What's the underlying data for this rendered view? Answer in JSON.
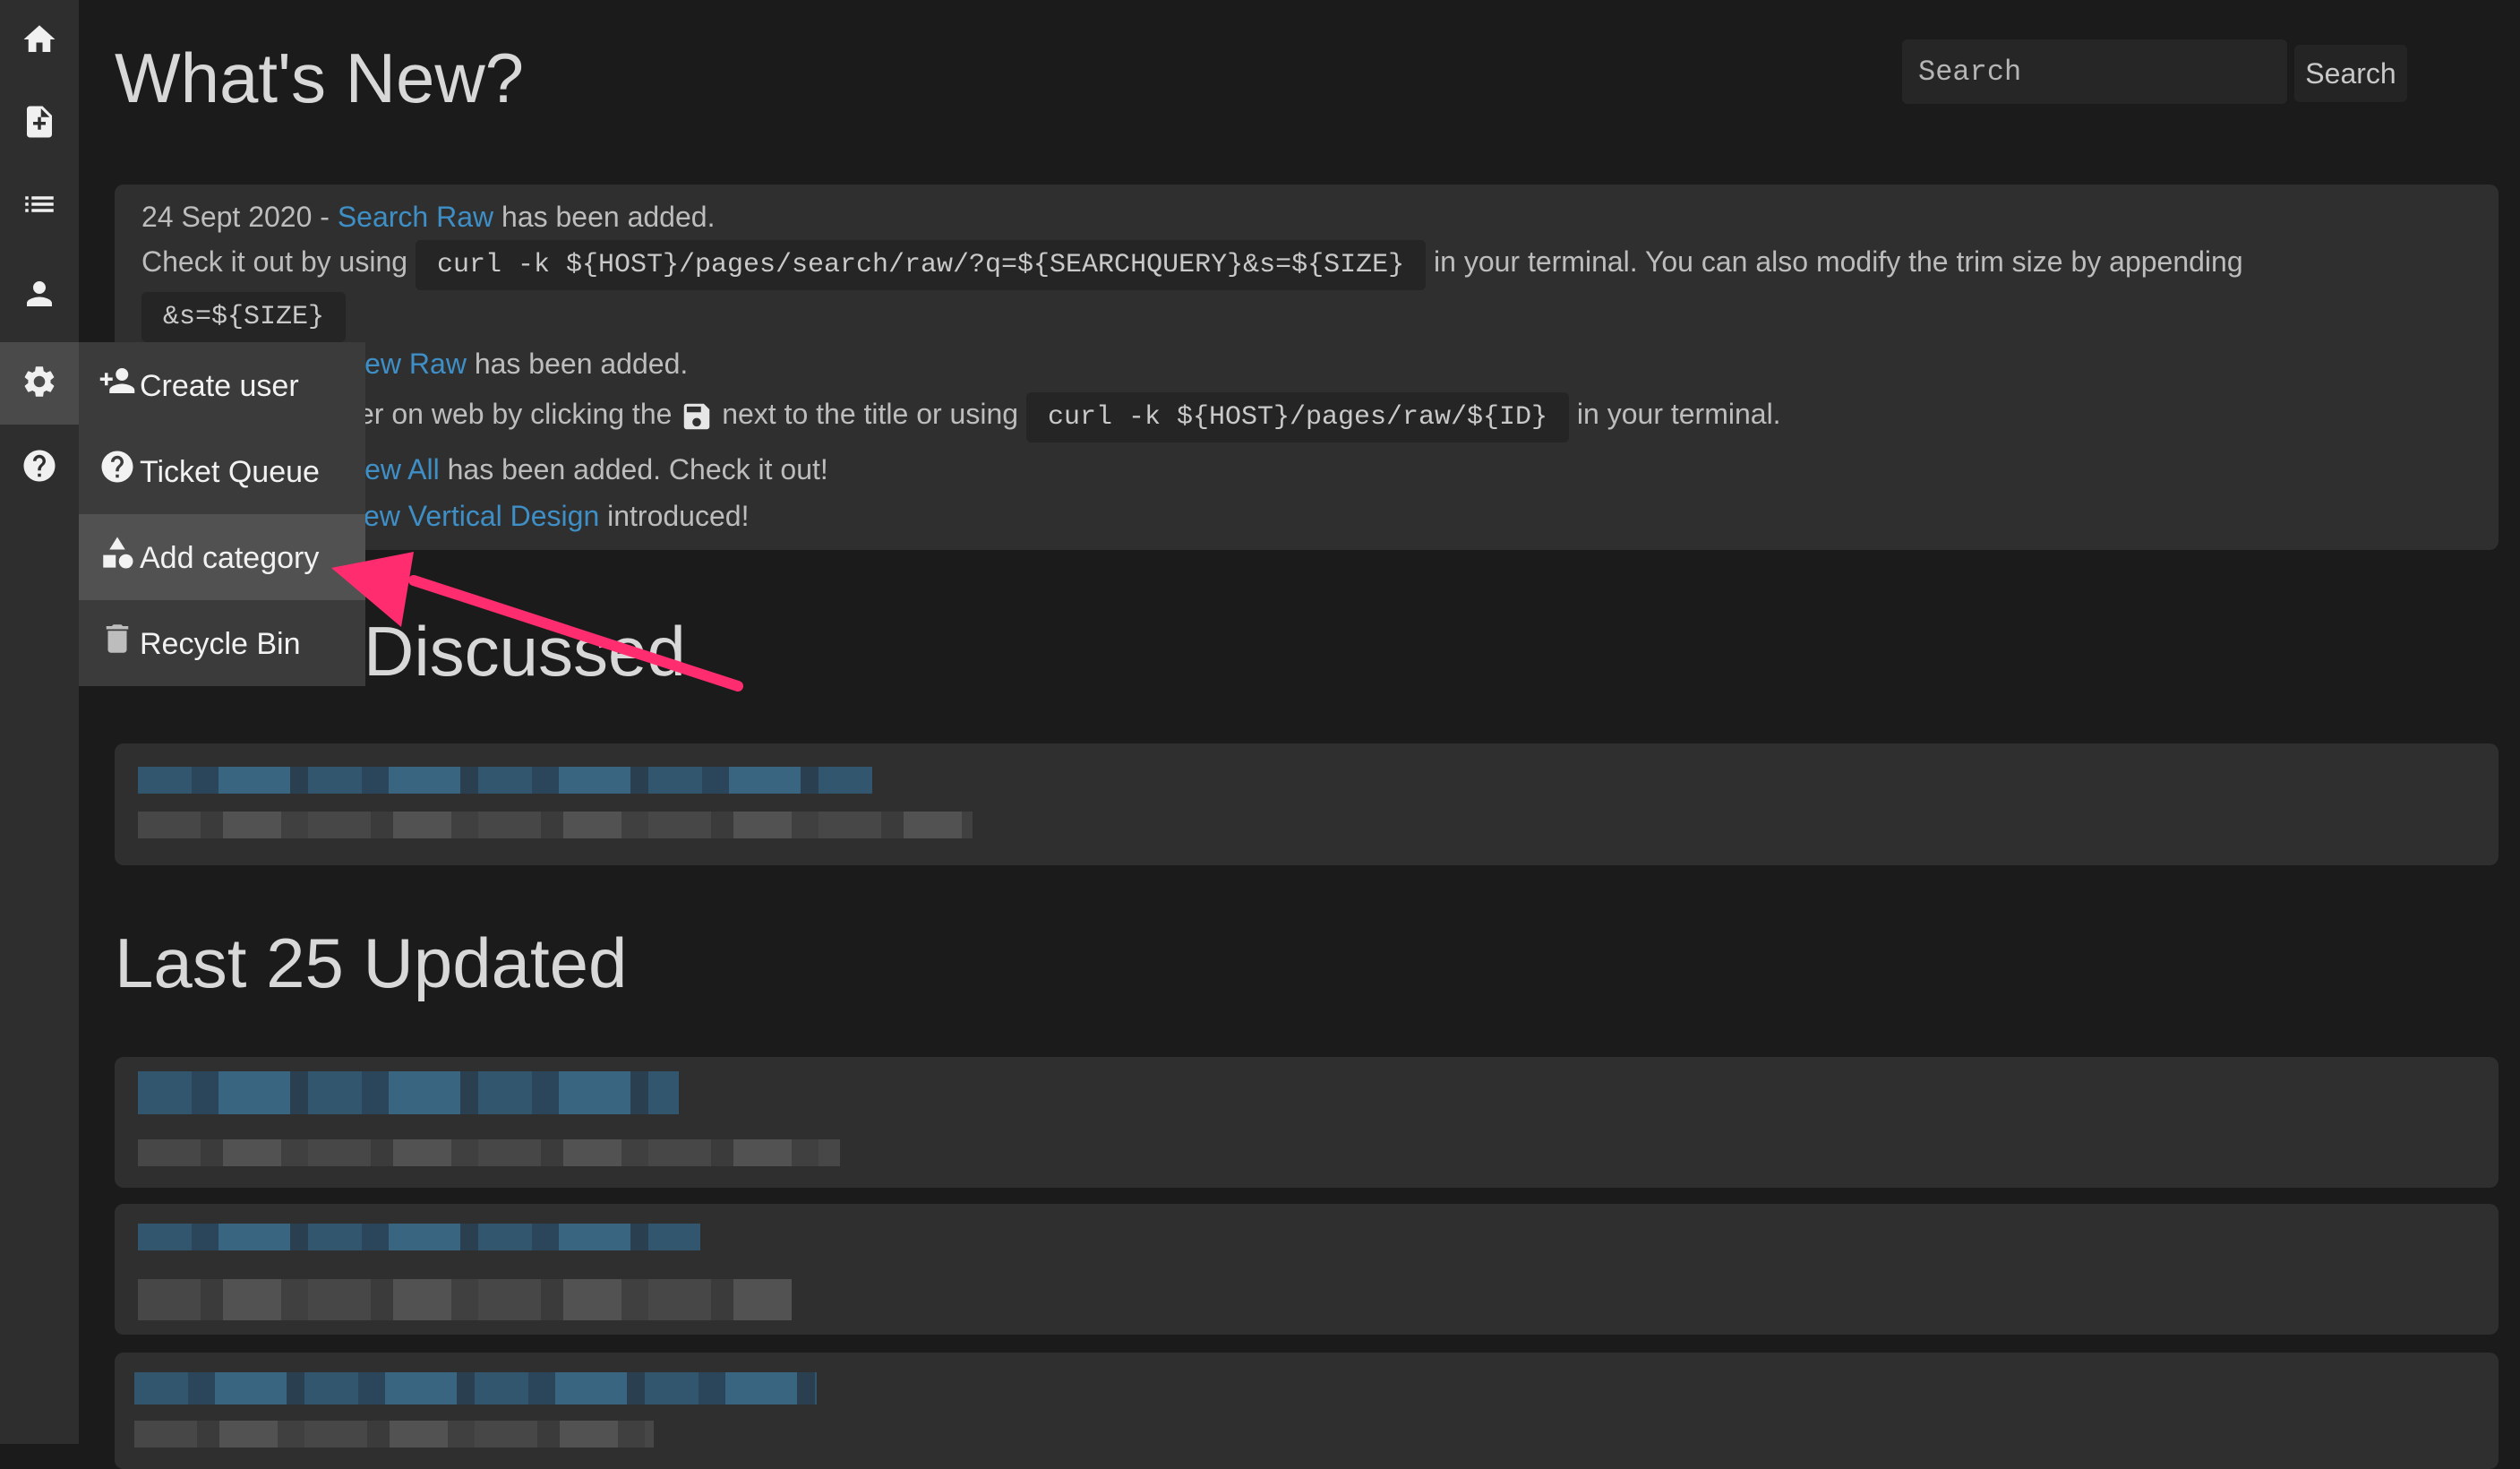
{
  "header": {
    "title": "What's New?",
    "search_placeholder": "Search",
    "search_button": "Search"
  },
  "rail": {
    "icons": [
      "home-icon",
      "new-document-icon",
      "list-icon",
      "user-icon",
      "gear-icon",
      "help-icon"
    ],
    "active": "gear-icon"
  },
  "flyout": {
    "items": [
      {
        "label": "Create user",
        "icon": "add-user-icon"
      },
      {
        "label": "Ticket Queue",
        "icon": "question-circle-icon"
      },
      {
        "label": "Add category",
        "icon": "shapes-icon",
        "highlighted": true
      },
      {
        "label": "Recycle Bin",
        "icon": "trash-icon"
      }
    ]
  },
  "news": {
    "line1": {
      "date": "24 Sept 2020 - ",
      "link": "Search Raw",
      "rest": " has been added."
    },
    "line2": {
      "pre": "Check it out by using",
      "code": "curl -k ${HOST}/pages/search/raw/?q=${SEARCHQUERY}&s=${SIZE}",
      "post": "in your terminal. You can also modify the trim size by appending"
    },
    "line3": {
      "code": "&s=${SIZE}"
    },
    "line4": {
      "link": "iew Raw",
      "rest": " has been added."
    },
    "line5": {
      "pre": "er on web by clicking the",
      "mid": "next to the title or using",
      "code": "curl -k ${HOST}/pages/raw/${ID}",
      "post": "in your terminal."
    },
    "line6": {
      "link": "iew All",
      "rest": " has been added. Check it out!"
    },
    "line7": {
      "link": "ew Vertical Design",
      "rest": " introduced!"
    }
  },
  "sections": {
    "discussed": "Discussed",
    "last_updated": "Last 25 Updated"
  },
  "colors": {
    "background": "#1b1b1b",
    "panel": "#2f2f2f",
    "link": "#3f8fc7",
    "annotation_arrow": "#ff2d6f"
  }
}
